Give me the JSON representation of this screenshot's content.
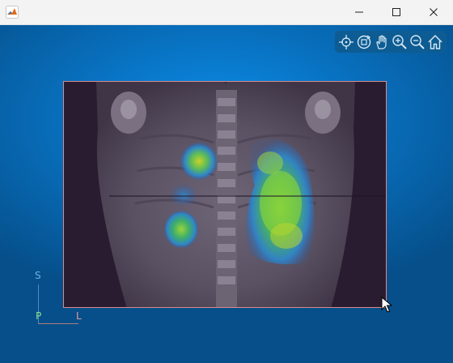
{
  "window": {
    "title_icon": "matlab-logo-icon",
    "controls": [
      "minimize-icon",
      "maximize-icon",
      "close-icon"
    ]
  },
  "toolbar": {
    "tools": [
      "datatips-icon",
      "rotate-3d-icon",
      "pan-hand-icon",
      "zoom-in-icon",
      "zoom-out-icon",
      "home-restore-view-icon"
    ]
  },
  "image": {
    "description_kind": "fused CT and PET coronal slice",
    "colormap_overlay": "parula",
    "crosshair_visible": true
  },
  "orientation": {
    "superior": "S",
    "posterior": "P",
    "left": "L"
  },
  "colors": {
    "figure_background": "#0977c9",
    "axes_border": "#d88a8a",
    "superior_label": "#6fb3e6",
    "posterior_label": "#8ce08c",
    "left_label": "#e69a9a"
  }
}
